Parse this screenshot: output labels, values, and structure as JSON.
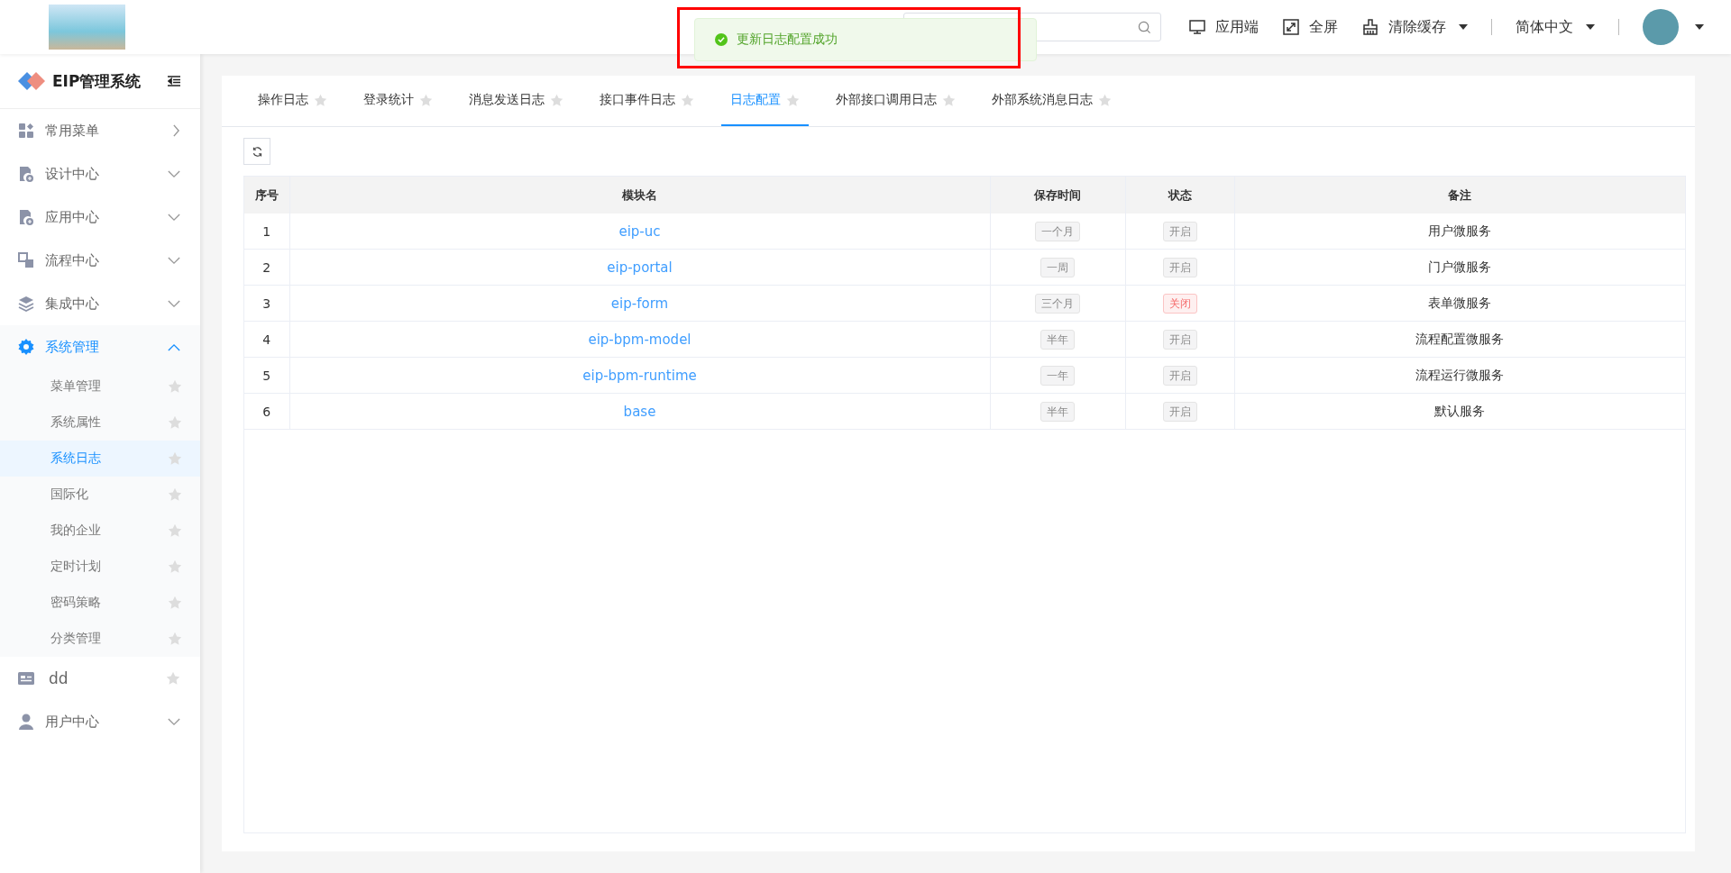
{
  "header": {
    "actions": [
      {
        "label": "应用端",
        "kind": "monitor",
        "dropdown": false
      },
      {
        "label": "全屏",
        "kind": "expand",
        "dropdown": false
      },
      {
        "label": "清除缓存",
        "kind": "broom",
        "dropdown": true
      }
    ],
    "language": "简体中文"
  },
  "toast": {
    "message": "更新日志配置成功"
  },
  "sidebar": {
    "title": "EIP管理系统",
    "items": [
      {
        "label": "常用菜单",
        "kind": "link",
        "selected": false
      },
      {
        "label": "设计中心",
        "kind": "group",
        "expanded": false,
        "selected": false
      },
      {
        "label": "应用中心",
        "kind": "group",
        "expanded": false,
        "selected": false
      },
      {
        "label": "流程中心",
        "kind": "group",
        "expanded": false,
        "selected": false
      },
      {
        "label": "集成中心",
        "kind": "group",
        "expanded": false,
        "selected": false
      },
      {
        "label": "系统管理",
        "kind": "group",
        "expanded": true,
        "selected": true,
        "children": [
          {
            "label": "菜单管理",
            "selected": false
          },
          {
            "label": "系统属性",
            "selected": false
          },
          {
            "label": "系统日志",
            "selected": true
          },
          {
            "label": "国际化",
            "selected": false
          },
          {
            "label": "我的企业",
            "selected": false
          },
          {
            "label": "定时计划",
            "selected": false
          },
          {
            "label": "密码策略",
            "selected": false
          },
          {
            "label": "分类管理",
            "selected": false
          }
        ]
      },
      {
        "label": "dd",
        "kind": "favorite",
        "selected": false
      },
      {
        "label": "用户中心",
        "kind": "group",
        "expanded": false,
        "selected": false
      }
    ]
  },
  "tabs": [
    {
      "label": "操作日志",
      "selected": false
    },
    {
      "label": "登录统计",
      "selected": false
    },
    {
      "label": "消息发送日志",
      "selected": false
    },
    {
      "label": "接口事件日志",
      "selected": false
    },
    {
      "label": "日志配置",
      "selected": true
    },
    {
      "label": "外部接口调用日志",
      "selected": false
    },
    {
      "label": "外部系统消息日志",
      "selected": false
    }
  ],
  "table": {
    "columns": [
      "序号",
      "模块名",
      "保存时间",
      "状态",
      "备注"
    ],
    "rows": [
      {
        "index": "1",
        "module": "eip-uc",
        "retention": "一个月",
        "status": "开启",
        "on": true,
        "remark": "用户微服务"
      },
      {
        "index": "2",
        "module": "eip-portal",
        "retention": "一周",
        "status": "开启",
        "on": true,
        "remark": "门户微服务"
      },
      {
        "index": "3",
        "module": "eip-form",
        "retention": "三个月",
        "status": "关闭",
        "on": false,
        "remark": "表单微服务"
      },
      {
        "index": "4",
        "module": "eip-bpm-model",
        "retention": "半年",
        "status": "开启",
        "on": true,
        "remark": "流程配置微服务"
      },
      {
        "index": "5",
        "module": "eip-bpm-runtime",
        "retention": "一年",
        "status": "开启",
        "on": true,
        "remark": "流程运行微服务"
      },
      {
        "index": "6",
        "module": "base",
        "retention": "半年",
        "status": "开启",
        "on": true,
        "remark": "默认服务"
      }
    ]
  }
}
